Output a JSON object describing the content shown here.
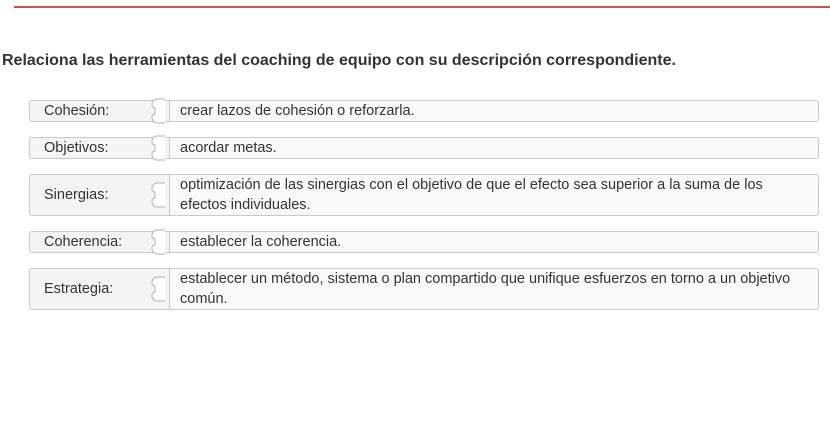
{
  "question": "Relaciona las herramientas del coaching de equipo con su descripción correspondiente.",
  "accent_color": "#d24d4d",
  "pairs": [
    {
      "term": "Cohesión:",
      "description": "crear lazos de cohesión o reforzarla."
    },
    {
      "term": "Objetivos:",
      "description": "acordar metas."
    },
    {
      "term": "Sinergias:",
      "description": "optimización de las sinergias con el objetivo de que el efecto sea superior a la suma de los efectos individuales."
    },
    {
      "term": "Coherencia:",
      "description": "establecer la coherencia."
    },
    {
      "term": "Estrategia:",
      "description": "establecer un método, sistema o plan compartido que unifique esfuerzos en torno a un objetivo común."
    }
  ],
  "icons": {
    "connector": "puzzle-connector-icon"
  }
}
